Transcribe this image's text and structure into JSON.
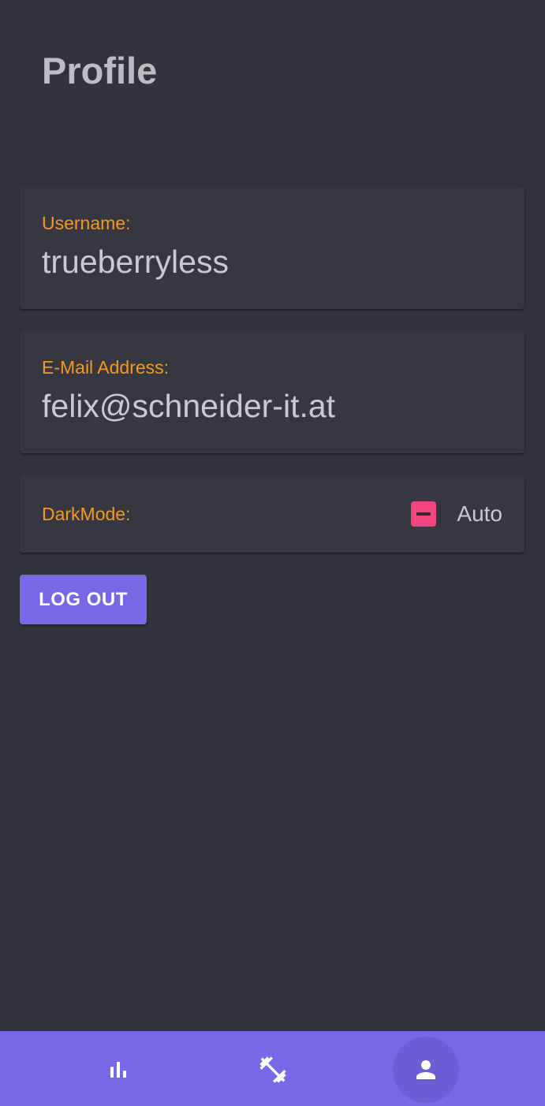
{
  "header": {
    "title": "Profile"
  },
  "profile": {
    "username_label": "Username:",
    "username_value": "trueberryless",
    "email_label": "E-Mail Address:",
    "email_value": "felix@schneider-it.at",
    "darkmode_label": "DarkMode:",
    "darkmode_value": "Auto",
    "darkmode_state": "indeterminate"
  },
  "actions": {
    "logout_label": "LOG OUT"
  },
  "bottom_nav": {
    "items": [
      {
        "icon": "bar-chart-icon",
        "active": false
      },
      {
        "icon": "dumbbell-icon",
        "active": false
      },
      {
        "icon": "person-icon",
        "active": true
      }
    ]
  },
  "colors": {
    "background": "#33333d",
    "card": "#373741",
    "label_accent": "#f39a1e",
    "primary": "#7768e5",
    "checkbox": "#f2457f"
  }
}
